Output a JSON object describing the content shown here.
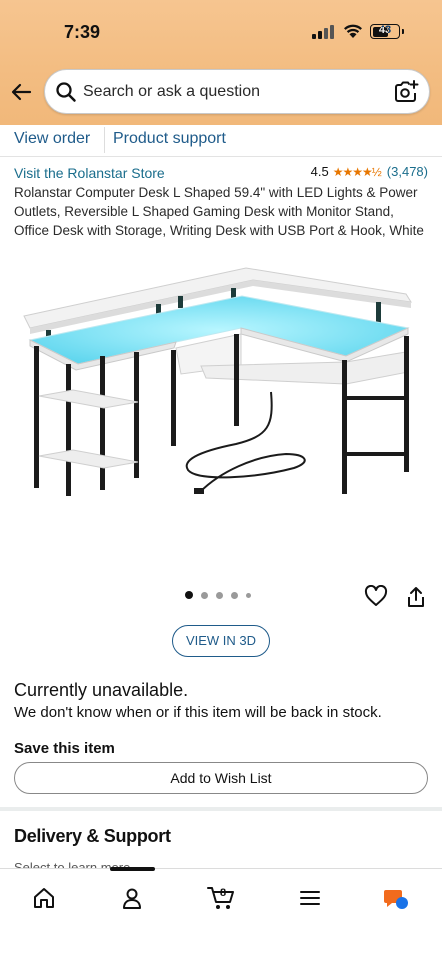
{
  "status_bar": {
    "time": "7:39",
    "battery": "43"
  },
  "search": {
    "placeholder": "Search or ask a question"
  },
  "subnav": {
    "view_order": "View order",
    "product_support": "Product support"
  },
  "product": {
    "store_link": "Visit the Rolanstar Store",
    "rating_value": "4.5",
    "rating_stars": "★★★★½",
    "rating_count": "(3,478)",
    "title": "Rolanstar Computer Desk L Shaped 59.4\" with LED Lights & Power Outlets, Reversible L Shaped Gaming Desk with Monitor Stand, Office Desk with Storage, Writing Desk with USB Port & Hook, White",
    "view_3d": "VIEW IN 3D",
    "availability": "Currently unavailable.",
    "availability_detail": "We don't know when or if this item will be back in stock.",
    "save_title": "Save this item",
    "wish_list_button": "Add to Wish List",
    "image_index": 1,
    "image_count": 5
  },
  "delivery": {
    "title": "Delivery & Support",
    "subtitle": "Select to learn more"
  },
  "bottom_nav": {
    "items": [
      "home-icon",
      "account-icon",
      "cart-icon",
      "menu-icon",
      "rufus-icon"
    ],
    "cart_count": "8"
  },
  "colors": {
    "header_gradient": "#f3bd82",
    "link": "#1f5b8a",
    "star": "#e77600",
    "accent_orange": "#f26b1d",
    "accent_blue": "#1a73e8"
  }
}
